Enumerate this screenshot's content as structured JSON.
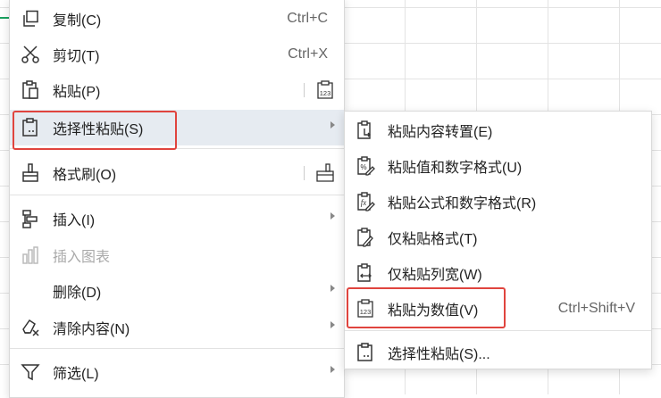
{
  "menu": {
    "items": [
      {
        "label": "复制(C)",
        "shortcut": "Ctrl+C",
        "icon": "copy-icon"
      },
      {
        "label": "剪切(T)",
        "shortcut": "Ctrl+X",
        "icon": "scissors-icon"
      },
      {
        "label": "粘贴(P)",
        "icon": "paste-icon",
        "right_icon": "paste-values-icon"
      },
      {
        "label": "选择性粘贴(S)",
        "icon": "paste-special-icon",
        "submenu": true
      },
      {
        "label": "格式刷(O)",
        "icon": "format-painter-icon",
        "right_icon": "format-painter-icon"
      },
      {
        "label": "插入(I)",
        "icon": "insert-icon",
        "submenu": true
      },
      {
        "label": "插入图表",
        "icon": "chart-icon",
        "disabled": true
      },
      {
        "label": "删除(D)",
        "submenu": true
      },
      {
        "label": "清除内容(N)",
        "icon": "eraser-icon",
        "submenu": true
      },
      {
        "label": "筛选(L)",
        "icon": "filter-icon",
        "submenu": true
      }
    ]
  },
  "submenu": {
    "items": [
      {
        "label": "粘贴内容转置(E)",
        "icon": "transpose-paste-icon"
      },
      {
        "label": "粘贴值和数字格式(U)",
        "icon": "paste-value-format-icon"
      },
      {
        "label": "粘贴公式和数字格式(R)",
        "icon": "paste-formula-format-icon"
      },
      {
        "label": "仅粘贴格式(T)",
        "icon": "paste-format-only-icon"
      },
      {
        "label": "仅粘贴列宽(W)",
        "icon": "paste-column-width-icon"
      },
      {
        "label": "粘贴为数值(V)",
        "shortcut": "Ctrl+Shift+V",
        "icon": "paste-values-icon"
      },
      {
        "label": "选择性粘贴(S)...",
        "icon": "paste-special-icon"
      }
    ]
  },
  "colors": {
    "highlight": "#e6ebf1",
    "annotation": "#e0443e",
    "accent": "#1aa260"
  }
}
